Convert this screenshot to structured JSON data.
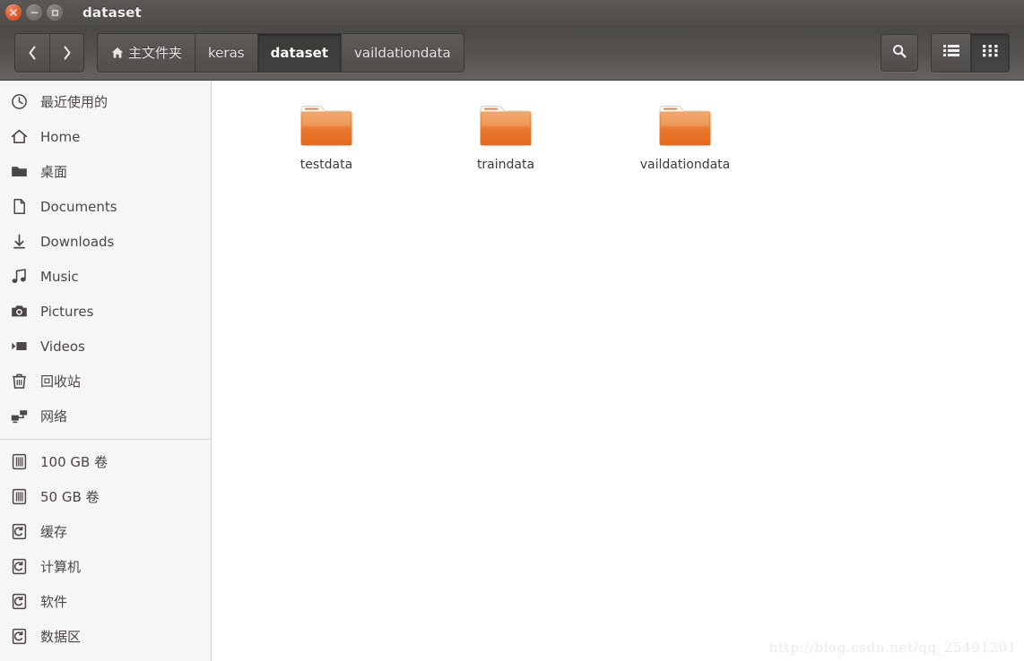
{
  "window": {
    "title": "dataset",
    "controls": [
      {
        "name": "close",
        "label": "Close",
        "color": "#e06137"
      },
      {
        "name": "minimize",
        "label": "Minimize",
        "color": "#777471"
      },
      {
        "name": "maximize",
        "label": "Maximize",
        "color": "#777471"
      }
    ]
  },
  "toolbar": {
    "back_label": "Back",
    "forward_label": "Forward",
    "breadcrumbs": [
      {
        "label": "主文件夹",
        "icon": "home-icon",
        "active": false
      },
      {
        "label": "keras",
        "icon": "",
        "active": false
      },
      {
        "label": "dataset",
        "icon": "",
        "active": true
      },
      {
        "label": "vaildationdata",
        "icon": "",
        "active": false
      }
    ],
    "search_label": "Search",
    "view_list_label": "List view",
    "view_grid_label": "Icon view",
    "active_view": "grid"
  },
  "sidebar": {
    "groups": [
      {
        "items": [
          {
            "label": "最近使用的",
            "icon": "clock-icon"
          },
          {
            "label": "Home",
            "icon": "home-icon"
          },
          {
            "label": "桌面",
            "icon": "folder-icon"
          },
          {
            "label": "Documents",
            "icon": "document-icon"
          },
          {
            "label": "Downloads",
            "icon": "download-icon"
          },
          {
            "label": "Music",
            "icon": "music-icon"
          },
          {
            "label": "Pictures",
            "icon": "camera-icon"
          },
          {
            "label": "Videos",
            "icon": "video-icon"
          },
          {
            "label": "回收站",
            "icon": "trash-icon"
          },
          {
            "label": "网络",
            "icon": "network-icon"
          }
        ]
      },
      {
        "items": [
          {
            "label": "100 GB 卷",
            "icon": "drive-icon"
          },
          {
            "label": "50 GB 卷",
            "icon": "drive-icon"
          },
          {
            "label": "缓存",
            "icon": "volume-icon"
          },
          {
            "label": "计算机",
            "icon": "volume-icon"
          },
          {
            "label": "软件",
            "icon": "volume-icon"
          },
          {
            "label": "数据区",
            "icon": "volume-icon"
          }
        ]
      }
    ]
  },
  "content": {
    "files": [
      {
        "name": "testdata",
        "type": "folder"
      },
      {
        "name": "traindata",
        "type": "folder"
      },
      {
        "name": "vaildationdata",
        "type": "folder"
      }
    ],
    "watermark": "http://blog.csdn.net/qq_25491201"
  },
  "colors": {
    "titlebar": "#504d4a",
    "toolbar": "#55524f",
    "sidebar_bg": "#f7f6f5",
    "content_bg": "#ffffff",
    "folder_orange": "#e8762c",
    "close_button": "#e06137"
  }
}
